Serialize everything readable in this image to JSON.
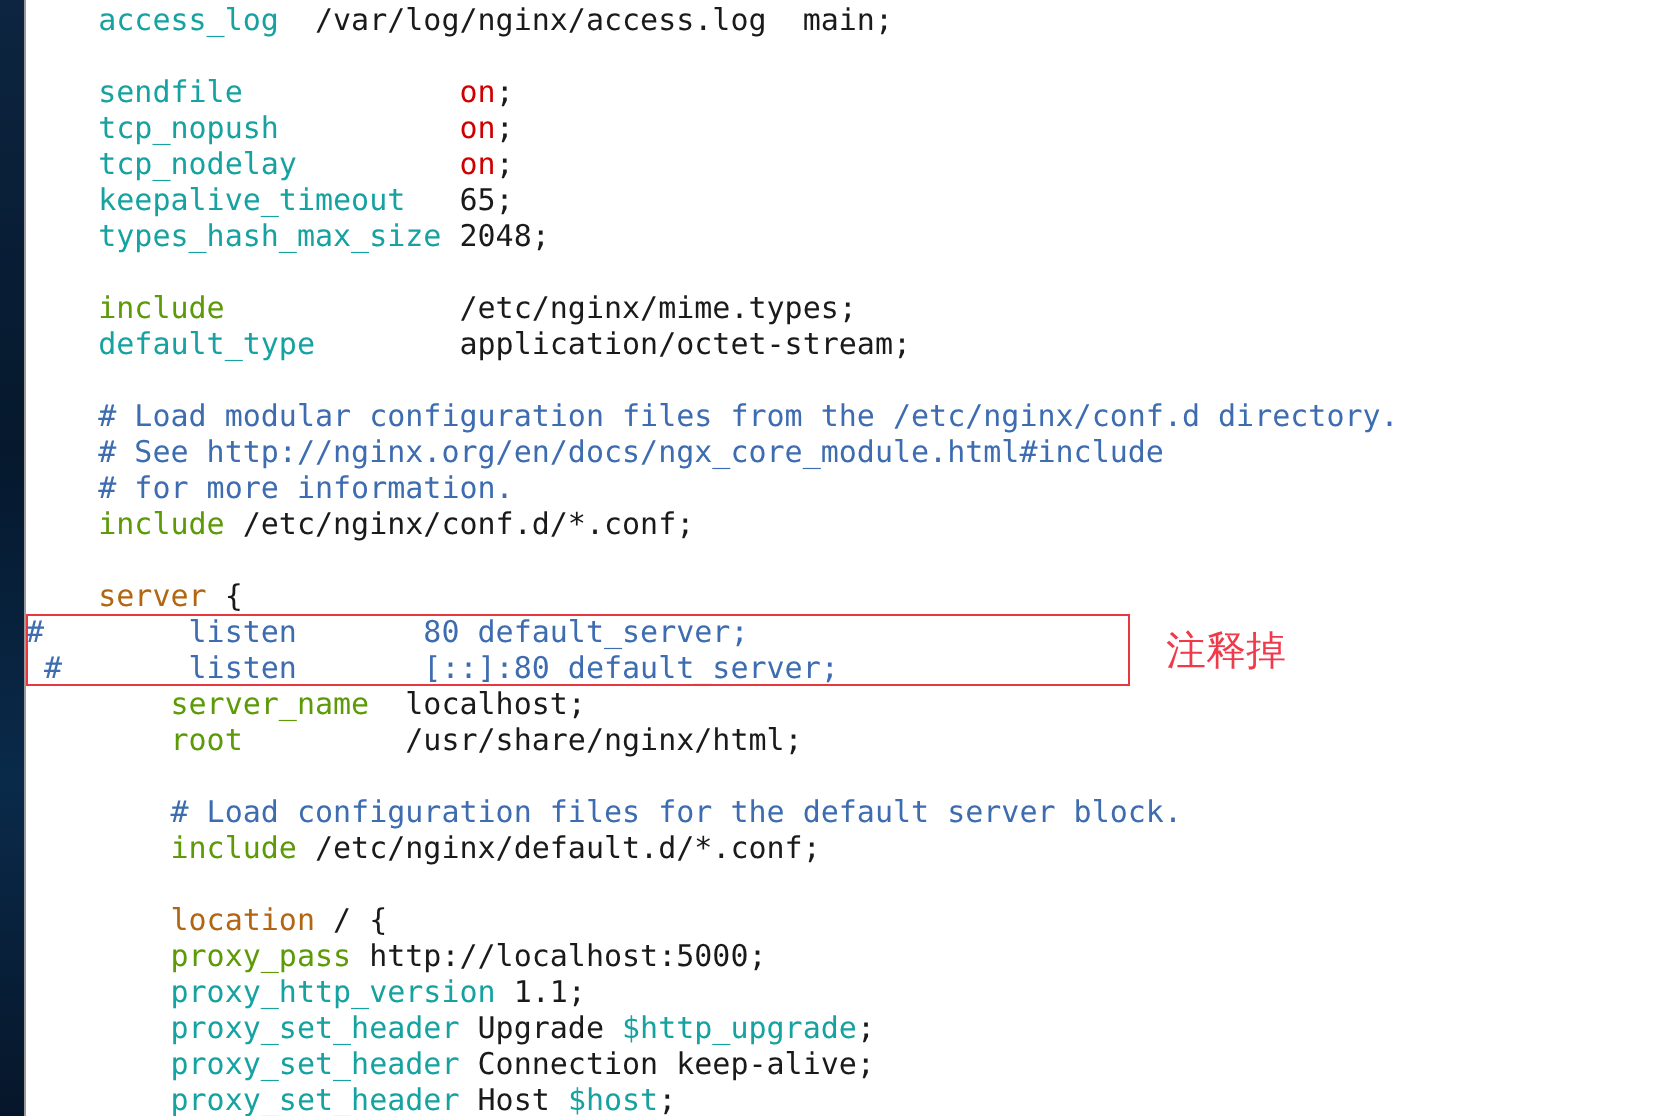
{
  "editor": {
    "lines": [
      {
        "kind": "code",
        "tokens": [
          {
            "kind": "directive",
            "text": "    access_log"
          },
          {
            "kind": "plain",
            "text": "  /var/log/nginx/access.log  main;"
          }
        ]
      },
      {
        "kind": "blank"
      },
      {
        "kind": "code",
        "tokens": [
          {
            "kind": "directive",
            "text": "    sendfile"
          },
          {
            "kind": "constant",
            "text": "            on"
          },
          {
            "kind": "plain",
            "text": ";"
          }
        ]
      },
      {
        "kind": "code",
        "tokens": [
          {
            "kind": "directive",
            "text": "    tcp_nopush"
          },
          {
            "kind": "constant",
            "text": "          on"
          },
          {
            "kind": "plain",
            "text": ";"
          }
        ]
      },
      {
        "kind": "code",
        "tokens": [
          {
            "kind": "directive",
            "text": "    tcp_nodelay"
          },
          {
            "kind": "constant",
            "text": "         on"
          },
          {
            "kind": "plain",
            "text": ";"
          }
        ]
      },
      {
        "kind": "code",
        "tokens": [
          {
            "kind": "directive",
            "text": "    keepalive_timeout"
          },
          {
            "kind": "plain",
            "text": "   65;"
          }
        ]
      },
      {
        "kind": "code",
        "tokens": [
          {
            "kind": "directive",
            "text": "    types_hash_max_size"
          },
          {
            "kind": "plain",
            "text": " 2048;"
          }
        ]
      },
      {
        "kind": "blank"
      },
      {
        "kind": "code",
        "tokens": [
          {
            "kind": "keyword",
            "text": "    include"
          },
          {
            "kind": "plain",
            "text": "             /etc/nginx/mime.types;"
          }
        ]
      },
      {
        "kind": "code",
        "tokens": [
          {
            "kind": "directive",
            "text": "    default_type"
          },
          {
            "kind": "plain",
            "text": "        application/octet-stream;"
          }
        ]
      },
      {
        "kind": "blank"
      },
      {
        "kind": "code",
        "tokens": [
          {
            "kind": "comment",
            "text": "    # Load modular configuration files from the /etc/nginx/conf.d directory."
          }
        ]
      },
      {
        "kind": "code",
        "tokens": [
          {
            "kind": "comment",
            "text": "    # See http://nginx.org/en/docs/ngx_core_module.html#include"
          }
        ]
      },
      {
        "kind": "code",
        "tokens": [
          {
            "kind": "comment",
            "text": "    # for more information."
          }
        ]
      },
      {
        "kind": "code",
        "tokens": [
          {
            "kind": "keyword",
            "text": "    include"
          },
          {
            "kind": "plain",
            "text": " /etc/nginx/conf.d/*.conf;"
          }
        ]
      },
      {
        "kind": "blank"
      },
      {
        "kind": "code",
        "tokens": [
          {
            "kind": "block",
            "text": "    server"
          },
          {
            "kind": "plain",
            "text": " {"
          }
        ]
      },
      {
        "kind": "code",
        "tokens": [
          {
            "kind": "comment",
            "text": "#        listen       80 default_server;"
          }
        ]
      },
      {
        "kind": "code",
        "tokens": [
          {
            "kind": "comment",
            "text": " #       listen       [::]:80 default_server;"
          }
        ]
      },
      {
        "kind": "code",
        "tokens": [
          {
            "kind": "keyword",
            "text": "        server_name"
          },
          {
            "kind": "plain",
            "text": "  localhost;"
          }
        ]
      },
      {
        "kind": "code",
        "tokens": [
          {
            "kind": "keyword",
            "text": "        root"
          },
          {
            "kind": "plain",
            "text": "         /usr/share/nginx/html;"
          }
        ]
      },
      {
        "kind": "blank"
      },
      {
        "kind": "code",
        "tokens": [
          {
            "kind": "comment",
            "text": "        # Load configuration files for the default server block."
          }
        ]
      },
      {
        "kind": "code",
        "tokens": [
          {
            "kind": "keyword",
            "text": "        include"
          },
          {
            "kind": "plain",
            "text": " /etc/nginx/default.d/*.conf;"
          }
        ]
      },
      {
        "kind": "blank"
      },
      {
        "kind": "code",
        "tokens": [
          {
            "kind": "block",
            "text": "        location"
          },
          {
            "kind": "plain",
            "text": " / {"
          }
        ]
      },
      {
        "kind": "code",
        "tokens": [
          {
            "kind": "keyword",
            "text": "        proxy_pass"
          },
          {
            "kind": "plain",
            "text": " http://localhost:5000;"
          }
        ]
      },
      {
        "kind": "code",
        "tokens": [
          {
            "kind": "directive",
            "text": "        proxy_http_version"
          },
          {
            "kind": "plain",
            "text": " 1.1;"
          }
        ]
      },
      {
        "kind": "code",
        "tokens": [
          {
            "kind": "directive",
            "text": "        proxy_set_header"
          },
          {
            "kind": "plain",
            "text": " Upgrade "
          },
          {
            "kind": "variable",
            "text": "$http_upgrade"
          },
          {
            "kind": "plain",
            "text": ";"
          }
        ]
      },
      {
        "kind": "code",
        "tokens": [
          {
            "kind": "directive",
            "text": "        proxy_set_header"
          },
          {
            "kind": "plain",
            "text": " Connection keep-alive;"
          }
        ]
      },
      {
        "kind": "code",
        "tokens": [
          {
            "kind": "directive",
            "text": "        proxy_set_header"
          },
          {
            "kind": "plain",
            "text": " Host "
          },
          {
            "kind": "variable",
            "text": "$host"
          },
          {
            "kind": "plain",
            "text": ";"
          }
        ]
      }
    ]
  },
  "annotation": {
    "label": "注释掉"
  }
}
